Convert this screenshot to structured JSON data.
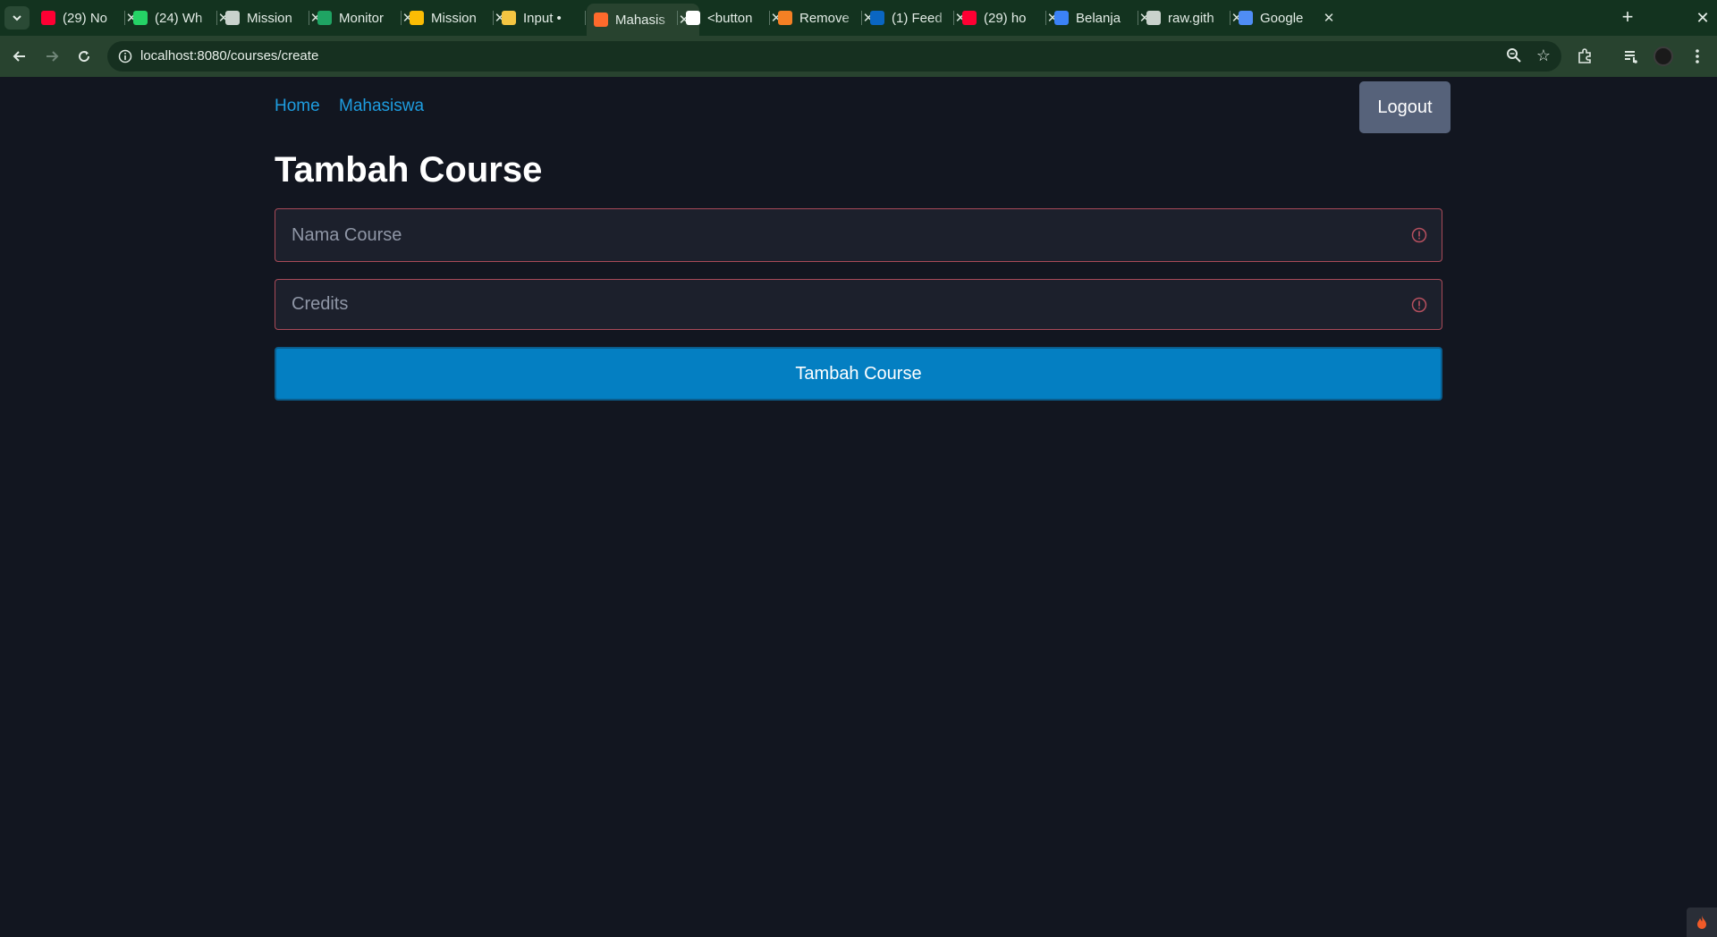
{
  "browser": {
    "tabs": [
      {
        "title": "(29) No",
        "favicon": "youtube-icon",
        "color": "#ff0033"
      },
      {
        "title": "(24) Wh",
        "favicon": "whatsapp-icon",
        "color": "#25d366"
      },
      {
        "title": "Mission",
        "favicon": "portrait-icon",
        "color": "#c9d2cc"
      },
      {
        "title": "Monitor",
        "favicon": "sheets-icon",
        "color": "#1fa463"
      },
      {
        "title": "Mission",
        "favicon": "drive-icon",
        "color": "#fbbc04"
      },
      {
        "title": "Input •",
        "favicon": "sparkle-icon",
        "color": "#f4c542"
      },
      {
        "title": "Mahasis",
        "favicon": "flame-icon",
        "color": "#ff6a2c",
        "active": true
      },
      {
        "title": "<button",
        "favicon": "m-logo-icon",
        "color": "#ffffff"
      },
      {
        "title": "Remove",
        "favicon": "stackoverflow-icon",
        "color": "#f48024"
      },
      {
        "title": "(1) Feed",
        "favicon": "linkedin-icon",
        "color": "#0a66c2"
      },
      {
        "title": "(29) ho",
        "favicon": "youtube-icon",
        "color": "#ff0033"
      },
      {
        "title": "Belanja",
        "favicon": "bag-icon",
        "color": "#3b82f6"
      },
      {
        "title": "raw.gith",
        "favicon": "globe-icon",
        "color": "#c9d2cc"
      },
      {
        "title": "Google",
        "favicon": "gemini-icon",
        "color": "#4f8df5"
      }
    ],
    "url": "localhost:8080/courses/create"
  },
  "nav": {
    "home": "Home",
    "mahasiswa": "Mahasiswa",
    "logout": "Logout"
  },
  "form": {
    "title": "Tambah Course",
    "name_placeholder": "Nama Course",
    "credits_placeholder": "Credits",
    "submit_label": "Tambah Course"
  },
  "colors": {
    "page_bg": "#121620",
    "link": "#1e9de0",
    "submit": "#047fc2",
    "error_border": "#a84a58"
  }
}
